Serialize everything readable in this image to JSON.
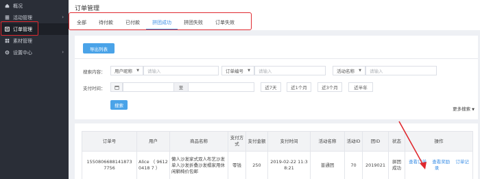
{
  "sidebar": {
    "items": [
      {
        "label": "概况",
        "icon": "home-icon"
      },
      {
        "label": "活动管理",
        "icon": "list-icon",
        "has_arrow": true
      },
      {
        "label": "订单管理",
        "icon": "order-icon",
        "active": true
      },
      {
        "label": "素材管理",
        "icon": "grid-icon"
      },
      {
        "label": "设置中心",
        "icon": "gear-icon",
        "has_arrow": true
      }
    ]
  },
  "header": {
    "title": "订单管理",
    "tabs": [
      "全部",
      "待付款",
      "已付款",
      "拼团成功",
      "拼团失败",
      "订单失效"
    ],
    "active_tab": 3
  },
  "filters": {
    "export_label": "导出列表",
    "search_label": "搜索内容：",
    "user_select": "用户昵称",
    "user_placeholder": "请输入",
    "order_select": "订单编号",
    "order_placeholder": "请输入",
    "activity_select": "活动名称",
    "activity_placeholder": "请输入",
    "pay_time_label": "支付时间：",
    "range_sep": "至",
    "quick_ranges": [
      "近7天",
      "近1个月",
      "近3个月",
      "近半年"
    ],
    "search_button": "搜索",
    "more_search": "更多搜索"
  },
  "table": {
    "headers": [
      "订单号",
      "用户",
      "商品名称",
      "支付方式",
      "支付金额",
      "支付时间",
      "活动名称",
      "活动ID",
      "团ID",
      "状态",
      "操作"
    ],
    "rows": [
      {
        "order_no": "1550806688141873 7756",
        "user": "Alice （ 96120418 7 ）",
        "product": "懒人沙发家式双人布艺沙发单人沙发折叠沙发榻家用休闲躺椅价包邮",
        "pay_method": "零钱",
        "amount": "250",
        "pay_time": "2019-02-22 11:3 8:21",
        "activity_name": "普通团",
        "activity_id": "70",
        "group_id": "2019021",
        "status": "拼团成功",
        "actions": [
          "查看订单",
          "查看奖励",
          "订单记录"
        ]
      }
    ]
  },
  "colors": {
    "accent": "#3a8ee6",
    "button": "#4aa3e8",
    "highlight": "#e0282e",
    "sidebar_bg": "#2a2e37"
  }
}
